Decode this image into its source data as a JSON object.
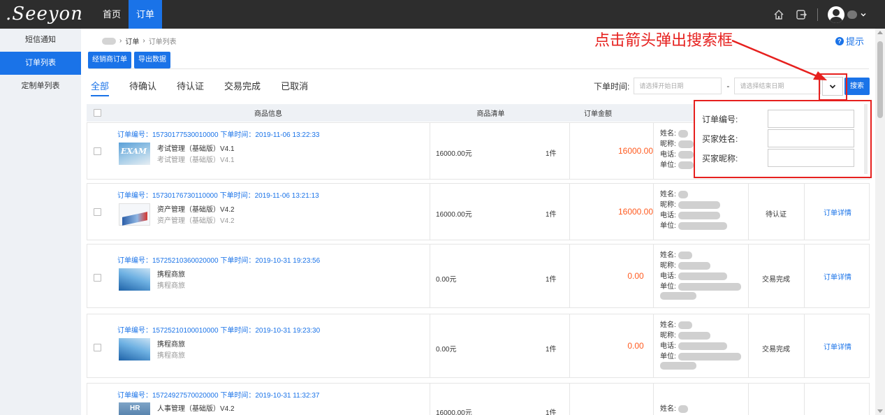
{
  "header": {
    "logo": ".Seeyon",
    "nav": [
      {
        "label": "首页"
      },
      {
        "label": "订单"
      }
    ]
  },
  "sidebar": {
    "items": [
      {
        "label": "短信通知"
      },
      {
        "label": "订单列表"
      },
      {
        "label": "定制单列表"
      }
    ]
  },
  "breadcrumb": {
    "level1": "订单",
    "level2": "订单列表"
  },
  "tip": "提示",
  "toolbar": {
    "dealer_order": "经销商订单",
    "export": "导出数据"
  },
  "tabs": [
    {
      "label": "全部"
    },
    {
      "label": "待确认"
    },
    {
      "label": "待认证"
    },
    {
      "label": "交易完成"
    },
    {
      "label": "已取消"
    }
  ],
  "filter": {
    "label": "下单时间:",
    "start_placeholder": "请选择开始日期",
    "dash": "-",
    "end_placeholder": "请选择结束日期",
    "search": "搜索"
  },
  "table": {
    "headers": [
      "商品信息",
      "商品清单",
      "订单金额"
    ]
  },
  "buyer_labels": {
    "name": "姓名:",
    "nick": "昵称:",
    "phone": "电话:",
    "unit": "单位:"
  },
  "orders": [
    {
      "head": "订单编号：15730177530010000 下单时间：2019-11-06 13:22:33",
      "product": "考试管理（基础版）V4.1",
      "product_sub": "考试管理（基础版）V4.1",
      "thumb_text": "EXAM",
      "price": "16000.00元",
      "qty": "1件",
      "amount": "16000.00",
      "status": "",
      "detail": ""
    },
    {
      "head": "订单编号：15730176730110000 下单时间：2019-11-06 13:21:13",
      "product": "资产管理（基础版）V4.2",
      "product_sub": "资产管理（基础版）V4.2",
      "price": "16000.00元",
      "qty": "1件",
      "amount": "16000.00",
      "status": "待认证",
      "detail": "订单详情"
    },
    {
      "head": "订单编号：15725210360020000 下单时间：2019-10-31 19:23:56",
      "product": "携程商旅",
      "product_sub": "携程商旅",
      "price": "0.00元",
      "qty": "1件",
      "amount": "0.00",
      "status": "交易完成",
      "detail": "订单详情"
    },
    {
      "head": "订单编号：15725210100010000 下单时间：2019-10-31 19:23:30",
      "product": "携程商旅",
      "product_sub": "携程商旅",
      "price": "0.00元",
      "qty": "1件",
      "amount": "0.00",
      "status": "交易完成",
      "detail": "订单详情"
    },
    {
      "head": "订单编号：15724927570020000 下单时间：2019-10-31 11:32:37",
      "product": "人事管理（基础版）V4.2",
      "thumb_text": "HR",
      "price": "16000.00元",
      "qty": "1件"
    }
  ],
  "annotation": {
    "text": "点击箭头弹出搜索框"
  },
  "popup": {
    "order_no": "订单编号:",
    "buyer_name": "买家姓名:",
    "buyer_nick": "买家昵称:"
  },
  "colors": {
    "primary": "#1a73e8",
    "header_bg": "#2d2d2d",
    "annotation": "#e6201e",
    "amount": "#ff5a1f"
  }
}
